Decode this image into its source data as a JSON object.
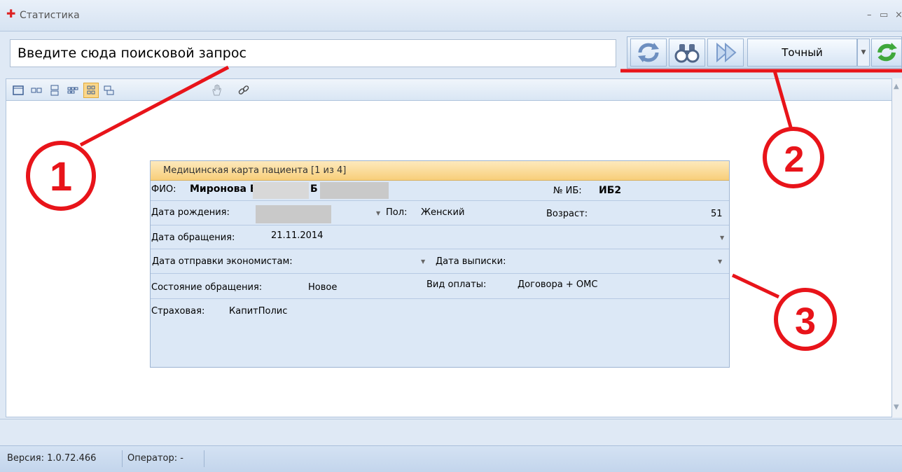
{
  "window": {
    "title": "Статистика",
    "controls": [
      "–",
      "▭",
      "×"
    ]
  },
  "search": {
    "value": "Введите сюда поисковой запрос",
    "mode_label": "Точный"
  },
  "card": {
    "title": "Медицинская карта пациента [1 из 4]",
    "fio_label": "ФИО:",
    "fio_value_1": "Миронова Е",
    "fio_value_2": "Б",
    "ib_label": "№ ИБ:",
    "ib_value": "ИБ2",
    "birth_label": "Дата рождения:",
    "sex_label": "Пол:",
    "sex_value": "Женский",
    "age_label": "Возраст:",
    "age_value": "51",
    "visit_label": "Дата обращения:",
    "visit_value": "21.11.2014",
    "econ_label": "Дата отправки экономистам:",
    "discharge_label": "Дата выписки:",
    "state_label": "Состояние обращения:",
    "state_value": "Новое",
    "pay_label": "Вид оплаты:",
    "pay_value": "Договора + ОМС",
    "insurer_label": "Страховая:",
    "insurer_value": "КапитПолис"
  },
  "status": {
    "version": "Версия: 1.0.72.466",
    "operator": "Оператор: -"
  },
  "annotations": {
    "one": "1",
    "two": "2",
    "three": "3"
  },
  "colors": {
    "annotation_red": "#e8141a",
    "active_layout": "#fbd78a",
    "card_header": "#f8cf7a"
  }
}
